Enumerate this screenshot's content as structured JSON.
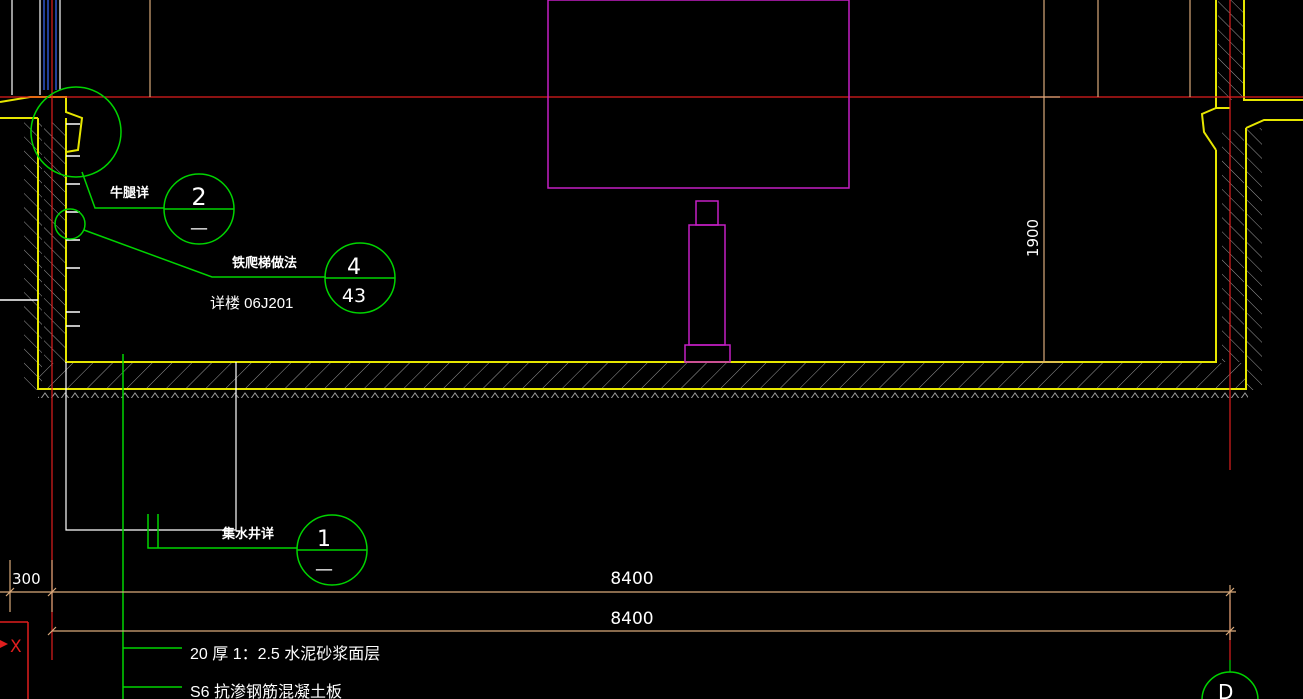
{
  "colors": {
    "background": "#000000",
    "wall": "#e6e600",
    "axis": "#e01e1e",
    "dimension": "#d9a97a",
    "callout": "#00d400",
    "equipment": "#c41fc4",
    "annotation": "#ffffff",
    "blue_line": "#3b6bff"
  },
  "labels": {
    "corbel_note": "牛腿详",
    "ladder_note": "铁爬梯做法",
    "ladder_ref": "详楼 06J201",
    "sump_note": "集水井详"
  },
  "callouts": {
    "c2": {
      "top": "2",
      "bottom": "—"
    },
    "c4": {
      "top": "4",
      "bottom": "43"
    },
    "c1": {
      "top": "1",
      "bottom": "—"
    }
  },
  "dimensions": {
    "height": "1900",
    "small": "300",
    "span_upper": "8400",
    "span_lower": "8400"
  },
  "layers": {
    "screed": "20  厚 1：2.5  水泥砂浆面层",
    "slab": "S6  抗渗钢筋混凝土板"
  },
  "axis_bubble": "D",
  "ucs": {
    "x": "X"
  }
}
